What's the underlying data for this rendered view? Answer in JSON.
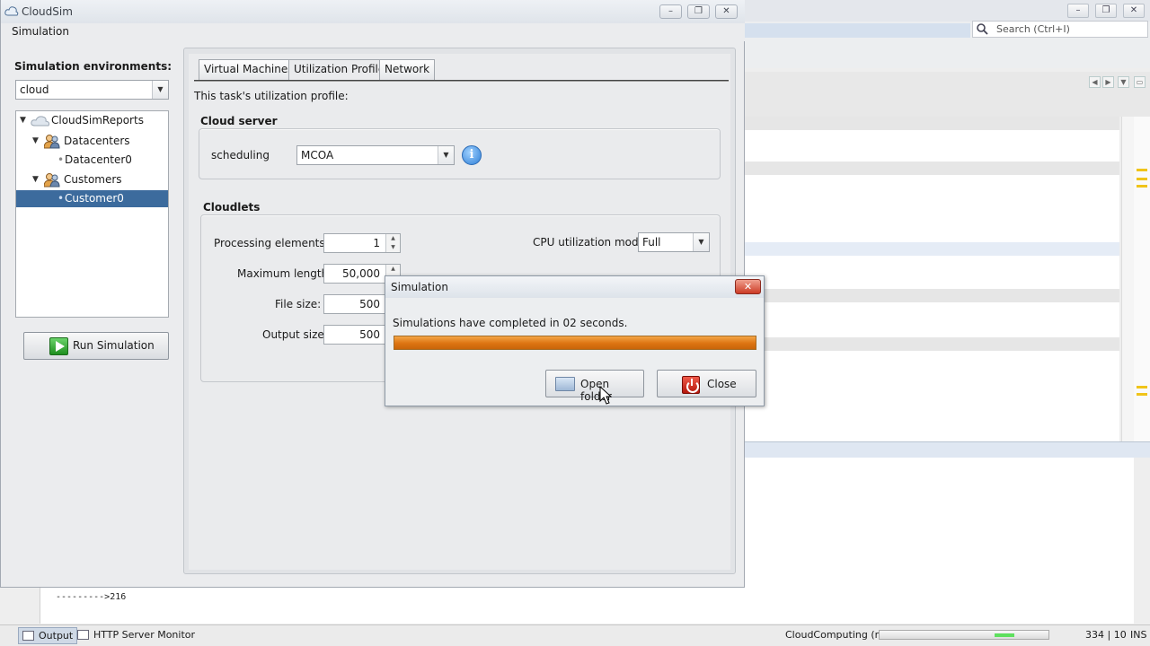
{
  "ide": {
    "search_placeholder": "Search (Ctrl+I)",
    "console_lines": [
      "--------->216"
    ],
    "status": {
      "tabs": [
        "Output",
        "HTTP Server Monitor"
      ],
      "task": "CloudComputing (run)",
      "position": "334 | 10",
      "mode": "INS"
    }
  },
  "window": {
    "title": "CloudSim",
    "menu": [
      "Simulation"
    ],
    "env_label": "Simulation environments:",
    "env_selected": "cloud",
    "tree": [
      {
        "label": "CloudSimReports"
      },
      {
        "label": "Datacenters"
      },
      {
        "label": "Datacenter0"
      },
      {
        "label": "Customers"
      },
      {
        "label": "Customer0",
        "selected": true
      }
    ],
    "run_button": "Run Simulation"
  },
  "profile": {
    "tabs": [
      "Virtual Machines",
      "Utilization Profile",
      "Network"
    ],
    "active_tab": "Utilization Profile",
    "intro": "This task's utilization profile:",
    "cloud_server": {
      "title": "Cloud server",
      "scheduling_label": "scheduling",
      "scheduling_value": "MCOA"
    },
    "cloudlets": {
      "title": "Cloudlets",
      "processing_elements_label": "Processing elements:",
      "processing_elements": "1",
      "max_length_label": "Maximum length:",
      "max_length": "50,000",
      "file_size_label": "File size:",
      "file_size": "500",
      "output_size_label": "Output size:",
      "output_size": "500",
      "cpu_model_label": "CPU utilization model:",
      "cpu_model": "Full"
    }
  },
  "dialog": {
    "title": "Simulation",
    "message": "Simulations have completed in 02 seconds.",
    "progress": 1.0,
    "open_folder": "Open folder",
    "close": "Close"
  },
  "colors": {
    "selection": "#3c6b9d",
    "progress": "#dd7412",
    "run_icon": "#2ea02e",
    "close_icon": "#cc2a1c"
  },
  "icons": [
    "cloud-icon",
    "users-icon",
    "info-icon",
    "folder-icon",
    "power-icon",
    "play-icon",
    "search-icon"
  ]
}
